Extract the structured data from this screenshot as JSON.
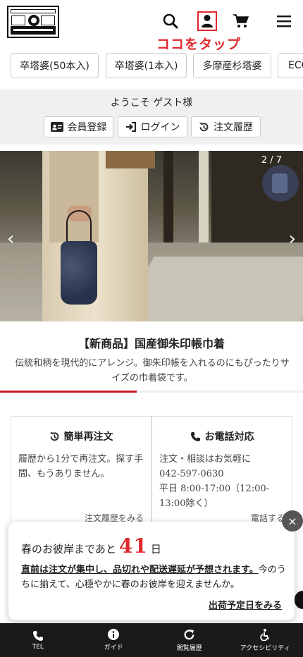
{
  "header": {
    "logo_alt": "logo",
    "tap_label": "ココをタップ"
  },
  "categories": [
    {
      "label": "卒塔婆(50本入)"
    },
    {
      "label": "卒塔婆(1本入)"
    },
    {
      "label": "多摩産杉塔婆"
    },
    {
      "label": "ECO"
    }
  ],
  "welcome": {
    "greeting": "ようこそ ゲスト様",
    "register_label": "会員登録",
    "login_label": "ログイン",
    "history_label": "注文履歴"
  },
  "slider": {
    "counter": "2 / 7",
    "prev_arrow": "‹",
    "next_arrow": "›",
    "progress": 0.45
  },
  "product": {
    "title": "【新商品】国産御朱印帳巾着",
    "description": "伝統和柄を現代的にアレンジ。御朱印帳を入れるのにもぴったりサイズの巾着袋です。"
  },
  "cards": {
    "reorder": {
      "title": "簡単再注文",
      "body": "履歴から1分で再注文。探す手間、もうありません。",
      "link": "注文履歴をみる"
    },
    "phone": {
      "title": "お電話対応",
      "body_line1": "注文・相談はお気軽に",
      "body_line2": "042-597-0630",
      "body_line3": "平日 8:00-17:00（12:00-13:00除く）",
      "link": "電話する"
    }
  },
  "popup": {
    "prefix": "春のお彼岸まであと",
    "days": "41",
    "suffix": "日",
    "warning": "直前は注文が集中し、品切れや配送遅延が予想されます。",
    "message": "今のうちに揃えて、心穏やかに春のお彼岸を迎えませんか。",
    "link": "出荷予定日をみる",
    "close": "×"
  },
  "bottom_nav": [
    {
      "label": "TEL",
      "icon": "phone-icon"
    },
    {
      "label": "ガイド",
      "icon": "info-icon"
    },
    {
      "label": "閲覧履歴",
      "icon": "refresh-icon"
    },
    {
      "label": "アクセシビリティ",
      "icon": "accessibility-icon"
    }
  ],
  "colors": {
    "accent": "#e0282e",
    "progress": "#c8161d",
    "nav_bg": "#1a1a1a"
  }
}
